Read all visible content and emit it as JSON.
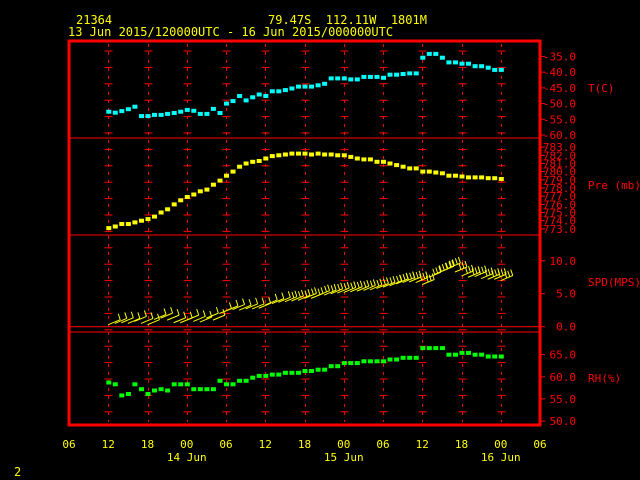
{
  "header": {
    "station": "21364",
    "location": "79.47S  112.11W  1801M",
    "period": "13 Jun 2015/120000UTC - 16 Jun 2015/000000UTC"
  },
  "page_number": "2",
  "colors": {
    "frame": "#ff0000",
    "grid": "#ff0000",
    "text": "#ffff00",
    "axis_labels": "#ff0000",
    "temperature": "#00ffff",
    "pressure": "#ffff00",
    "wind": "#ffff00",
    "humidity": "#00ff00"
  },
  "chart_data": {
    "type": "scatter",
    "x_axis": {
      "tick_labels": [
        "06",
        "12",
        "18",
        "00",
        "06",
        "12",
        "18",
        "00",
        "06",
        "12",
        "18",
        "00",
        "06"
      ],
      "day_labels": [
        "14 Jun",
        "15 Jun",
        "16 Jun"
      ],
      "tick_hours": [
        -6,
        0,
        6,
        12,
        18,
        24,
        30,
        36,
        42,
        48,
        54,
        60,
        66
      ],
      "day_label_hours": [
        12,
        36,
        60
      ],
      "xlim_hours_from_13Jun12UTC": [
        -6,
        66
      ]
    },
    "panels": [
      {
        "name": "temperature",
        "ylabel": "T(C)",
        "ylim": [
          -60,
          -32
        ],
        "tick_values": [
          -35,
          -40,
          -45,
          -50,
          -55,
          -60
        ],
        "tick_labels": [
          "-35.0",
          "-40.0",
          "-45.0",
          "-50.0",
          "-55.0",
          "-60.0"
        ],
        "x_hours": [
          0,
          1,
          2,
          3,
          4,
          5,
          6,
          7,
          8,
          9,
          10,
          11,
          12,
          13,
          14,
          15,
          16,
          17,
          18,
          19,
          20,
          21,
          22,
          23,
          24,
          25,
          26,
          27,
          28,
          29,
          30,
          31,
          32,
          33,
          34,
          35,
          36,
          37,
          38,
          39,
          40,
          41,
          42,
          43,
          44,
          45,
          46,
          47,
          48,
          49,
          50,
          51,
          52,
          53,
          54,
          55,
          56,
          57,
          58,
          59,
          60
        ],
        "values": [
          -52.6,
          -52.9,
          -52.4,
          -51.8,
          -51.0,
          -54.0,
          -54.0,
          -53.6,
          -53.6,
          -53.3,
          -53.0,
          -52.6,
          -52.0,
          -52.3,
          -53.3,
          -53.3,
          -51.7,
          -53.0,
          -50.0,
          -49.2,
          -47.6,
          -49.0,
          -48.0,
          -47.1,
          -47.6,
          -46.1,
          -46.1,
          -45.7,
          -45.2,
          -44.6,
          -44.6,
          -44.6,
          -44.2,
          -43.7,
          -42.0,
          -42.0,
          -42.0,
          -42.3,
          -42.3,
          -41.5,
          -41.5,
          -41.5,
          -41.8,
          -40.8,
          -40.8,
          -40.6,
          -40.4,
          -40.4,
          -35.4,
          -34.2,
          -34.2,
          -35.4,
          -36.9,
          -36.9,
          -37.3,
          -37.3,
          -38.1,
          -38.1,
          -38.6,
          -39.3,
          -39.3
        ]
      },
      {
        "name": "pressure",
        "ylabel": "Pre (mb)",
        "ylim": [
          772.5,
          783.5
        ],
        "tick_values": [
          783,
          782,
          781,
          780,
          779,
          778,
          777,
          776,
          775,
          774,
          773
        ],
        "tick_labels": [
          "783.0",
          "782.0",
          "781.0",
          "780.0",
          "779.0",
          "778.0",
          "777.0",
          "776.0",
          "775.0",
          "774.0",
          "773.0"
        ],
        "x_hours": [
          0,
          1,
          2,
          3,
          4,
          5,
          6,
          7,
          8,
          9,
          10,
          11,
          12,
          13,
          14,
          15,
          16,
          17,
          18,
          19,
          20,
          21,
          22,
          23,
          24,
          25,
          26,
          27,
          28,
          29,
          30,
          31,
          32,
          33,
          34,
          35,
          36,
          37,
          38,
          39,
          40,
          41,
          42,
          43,
          44,
          45,
          46,
          47,
          48,
          49,
          50,
          51,
          52,
          53,
          54,
          55,
          56,
          57,
          58,
          59,
          60
        ],
        "values": [
          773.1,
          773.3,
          773.6,
          773.6,
          773.8,
          774.0,
          774.2,
          774.5,
          775.0,
          775.4,
          776.0,
          776.5,
          776.9,
          777.2,
          777.6,
          777.8,
          778.4,
          778.9,
          779.5,
          780.0,
          780.6,
          781.0,
          781.2,
          781.3,
          781.6,
          781.9,
          782.0,
          782.1,
          782.2,
          782.2,
          782.2,
          782.1,
          782.2,
          782.1,
          782.1,
          782.0,
          782.0,
          781.8,
          781.6,
          781.5,
          781.5,
          781.2,
          781.2,
          781.0,
          780.8,
          780.6,
          780.4,
          780.4,
          780.0,
          780.0,
          779.9,
          779.8,
          779.5,
          779.5,
          779.4,
          779.3,
          779.3,
          779.3,
          779.2,
          779.2,
          779.1
        ]
      },
      {
        "name": "wind_speed",
        "ylabel": "SPD(MPS)",
        "ylim": [
          -0.5,
          13
        ],
        "tick_values": [
          10,
          5,
          0
        ],
        "tick_labels": [
          "10.0",
          "5.0",
          "0.0"
        ],
        "x_hours": [
          0,
          1,
          2,
          3,
          4,
          5,
          6,
          7,
          8,
          9,
          10,
          11,
          12,
          13,
          14,
          15,
          16,
          17,
          18,
          19,
          20,
          21,
          22,
          23,
          24,
          25,
          26,
          27,
          28,
          29,
          30,
          31,
          32,
          33,
          34,
          35,
          36,
          37,
          38,
          39,
          40,
          41,
          42,
          43,
          44,
          45,
          46,
          47,
          48,
          49,
          50,
          51,
          52,
          53,
          54,
          55,
          56,
          57,
          58,
          59,
          60
        ],
        "values": [
          0.3,
          0.5,
          0.6,
          0.5,
          0.8,
          0.5,
          0.3,
          1.1,
          1.3,
          1.0,
          0.6,
          0.6,
          1.0,
          0.8,
          0.7,
          1.3,
          1.0,
          2.0,
          2.4,
          2.6,
          2.5,
          2.7,
          2.7,
          2.8,
          3.3,
          3.5,
          3.7,
          3.8,
          3.9,
          4.0,
          4.3,
          4.3,
          4.7,
          4.8,
          5.0,
          5.1,
          5.2,
          5.3,
          5.4,
          5.5,
          5.6,
          5.8,
          6.0,
          6.2,
          6.5,
          6.7,
          6.8,
          6.7,
          6.4,
          7.5,
          8.0,
          8.4,
          8.9,
          8.3,
          7.7,
          7.5,
          7.6,
          7.3,
          7.2,
          7.2,
          7.0
        ]
      },
      {
        "name": "relative_humidity",
        "ylabel": "RH(%)",
        "ylim": [
          50,
          69
        ],
        "tick_values": [
          65,
          60,
          55,
          50
        ],
        "tick_labels": [
          "65.0",
          "60.0",
          "55.0",
          "50.0"
        ],
        "x_hours": [
          0,
          1,
          2,
          3,
          4,
          5,
          6,
          7,
          8,
          9,
          10,
          11,
          12,
          13,
          14,
          15,
          16,
          17,
          18,
          19,
          20,
          21,
          22,
          23,
          24,
          25,
          26,
          27,
          28,
          29,
          30,
          31,
          32,
          33,
          34,
          35,
          36,
          37,
          38,
          39,
          40,
          41,
          42,
          43,
          44,
          45,
          46,
          47,
          48,
          49,
          50,
          51,
          52,
          53,
          54,
          55,
          56,
          57,
          58,
          59,
          60
        ],
        "values": [
          58.7,
          58.3,
          55.8,
          56.1,
          58.3,
          57.2,
          56.1,
          56.9,
          57.2,
          56.9,
          58.3,
          58.3,
          58.3,
          57.2,
          57.2,
          57.2,
          57.2,
          59.1,
          58.3,
          58.3,
          59.1,
          59.1,
          59.8,
          60.2,
          60.2,
          60.5,
          60.5,
          60.9,
          60.9,
          60.9,
          61.3,
          61.3,
          61.6,
          61.6,
          62.4,
          62.4,
          63.1,
          63.1,
          63.1,
          63.5,
          63.5,
          63.5,
          63.5,
          63.9,
          63.9,
          64.3,
          64.3,
          64.3,
          66.5,
          66.5,
          66.5,
          66.5,
          65.0,
          65.0,
          65.4,
          65.4,
          65.0,
          65.0,
          64.6,
          64.6,
          64.6
        ]
      }
    ]
  }
}
